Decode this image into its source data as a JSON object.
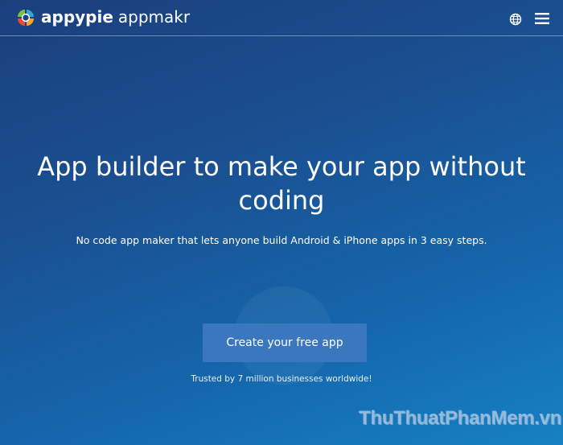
{
  "header": {
    "brand_primary": "appypie",
    "brand_secondary": "appmakr",
    "logo_icon": "appypie-logo-icon",
    "language_icon": "globe-icon",
    "menu_icon": "hamburger-menu-icon"
  },
  "hero": {
    "headline": "App builder to make your app without coding",
    "subtitle": "No code app maker that lets anyone build Android & iPhone apps in 3 easy steps.",
    "cta_label": "Create your free app",
    "trust_text": "Trusted by 7 million businesses worldwide!"
  },
  "watermark": {
    "text": "ThuThuatPhanMem.vn"
  },
  "colors": {
    "background_top": "#1b3f7c",
    "background_bottom": "#1681c4",
    "cta_background": "#3a77bf",
    "logo_green": "#7cc242",
    "logo_blue": "#2fa6e0",
    "logo_orange": "#f5a623",
    "logo_red": "#e94b35"
  }
}
